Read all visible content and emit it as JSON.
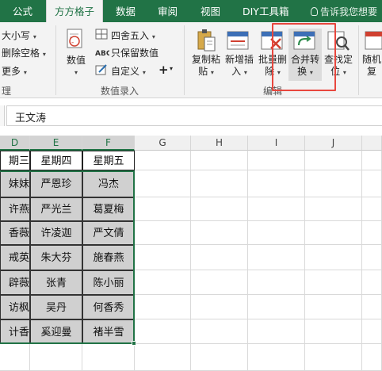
{
  "tabs": [
    {
      "label": "公式",
      "active": false
    },
    {
      "label": "方方格子",
      "active": true
    },
    {
      "label": "数据",
      "active": false
    },
    {
      "label": "审阅",
      "active": false
    },
    {
      "label": "视图",
      "active": false
    },
    {
      "label": "DIY工具箱",
      "active": false
    }
  ],
  "tell_me": "告诉我您想要",
  "ribbon": {
    "left_group": {
      "item1": "大小写",
      "item2": "删除空格",
      "item3": "更多",
      "label": "理"
    },
    "number_group": {
      "big_label": "数值",
      "small1": "四舍五入",
      "small2": "只保留数值",
      "small3": "自定义",
      "plus": "+",
      "label": "数值录入"
    },
    "edit_group": {
      "copy_paste": [
        "复制粘",
        "贴"
      ],
      "add_insert": [
        "新增插",
        "入"
      ],
      "batch_delete": [
        "批量删",
        "除"
      ],
      "merge_convert": [
        "合并转",
        "换"
      ],
      "find_locate": [
        "查找定",
        "位"
      ],
      "label": "编辑"
    },
    "random": [
      "随机",
      "复"
    ]
  },
  "formula_bar": {
    "value": "王文涛"
  },
  "columns": [
    "D",
    "E",
    "F",
    "G",
    "H",
    "I",
    "J"
  ],
  "header_row": [
    "期三",
    "星期四",
    "星期五"
  ],
  "data_rows": [
    [
      "妹妹",
      "严恩珍",
      "冯杰"
    ],
    [
      "许燕",
      "严光兰",
      "葛夏梅"
    ],
    [
      "香薇",
      "许凌迦",
      "严文倩"
    ],
    [
      "戒英",
      "朱大芬",
      "施春燕"
    ],
    [
      "辟薇",
      "张青",
      "陈小丽"
    ],
    [
      "访枫",
      "吴丹",
      "何香秀"
    ],
    [
      "计香",
      "奚迎曼",
      "褚半雪"
    ]
  ]
}
